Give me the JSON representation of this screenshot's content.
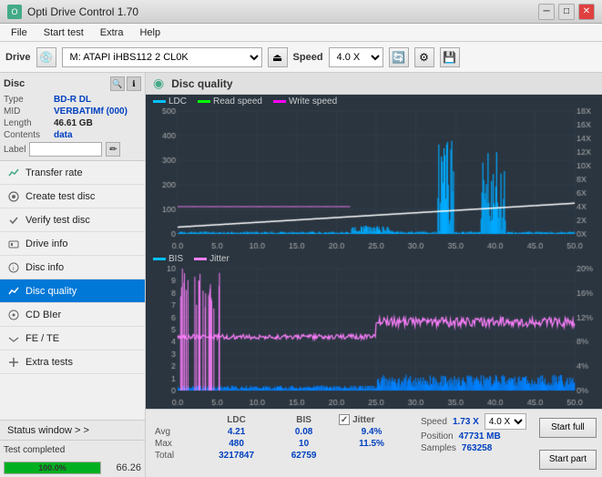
{
  "titlebar": {
    "title": "Opti Drive Control 1.70",
    "minimize": "─",
    "maximize": "□",
    "close": "✕"
  },
  "menubar": {
    "items": [
      "File",
      "Start test",
      "Extra",
      "Help"
    ]
  },
  "toolbar": {
    "drive_label": "Drive",
    "drive_value": "(M:) ATAPI iHBS112  2 CL0K",
    "speed_label": "Speed",
    "speed_value": "4.0 X"
  },
  "disc": {
    "title": "Disc",
    "type_label": "Type",
    "type_value": "BD-R DL",
    "mid_label": "MID",
    "mid_value": "VERBATIMf (000)",
    "length_label": "Length",
    "length_value": "46.61 GB",
    "contents_label": "Contents",
    "contents_value": "data",
    "label_label": "Label"
  },
  "nav": {
    "items": [
      {
        "id": "transfer-rate",
        "label": "Transfer rate",
        "icon": "chart"
      },
      {
        "id": "create-test-disc",
        "label": "Create test disc",
        "icon": "disc"
      },
      {
        "id": "verify-test-disc",
        "label": "Verify test disc",
        "icon": "check"
      },
      {
        "id": "drive-info",
        "label": "Drive info",
        "icon": "info"
      },
      {
        "id": "disc-info",
        "label": "Disc info",
        "icon": "disc-info"
      },
      {
        "id": "disc-quality",
        "label": "Disc quality",
        "icon": "quality",
        "active": true
      },
      {
        "id": "cd-bier",
        "label": "CD BIer",
        "icon": "cd"
      },
      {
        "id": "fe-te",
        "label": "FE / TE",
        "icon": "fe"
      },
      {
        "id": "extra-tests",
        "label": "Extra tests",
        "icon": "extra"
      }
    ]
  },
  "chart": {
    "title": "Disc quality",
    "top_legend": [
      "LDC",
      "Read speed",
      "Write speed"
    ],
    "top_y_max": 500,
    "top_y_right_max": 18,
    "bottom_legend": [
      "BIS",
      "Jitter"
    ],
    "bottom_y_max": 10,
    "bottom_y_right_max": 20,
    "x_max": 50
  },
  "stats": {
    "headers": [
      "LDC",
      "BIS",
      "",
      "Jitter",
      "Speed",
      ""
    ],
    "avg_label": "Avg",
    "avg_ldc": "4.21",
    "avg_bis": "0.08",
    "avg_jitter": "9.4%",
    "avg_speed": "1.73 X",
    "avg_speed2": "4.0 X",
    "max_label": "Max",
    "max_ldc": "480",
    "max_bis": "10",
    "max_jitter": "11.5%",
    "max_position": "Position",
    "max_position_val": "47731 MB",
    "total_label": "Total",
    "total_ldc": "3217847",
    "total_bis": "62759",
    "total_samples": "Samples",
    "total_samples_val": "763258",
    "jitter_checked": true,
    "btn_start_full": "Start full",
    "btn_start_part": "Start part"
  },
  "statusbar": {
    "status_window": "Status window > >",
    "status_text": "Test completed",
    "progress_pct": "100.0%",
    "progress_width": 100,
    "speed_display": "66.26"
  }
}
